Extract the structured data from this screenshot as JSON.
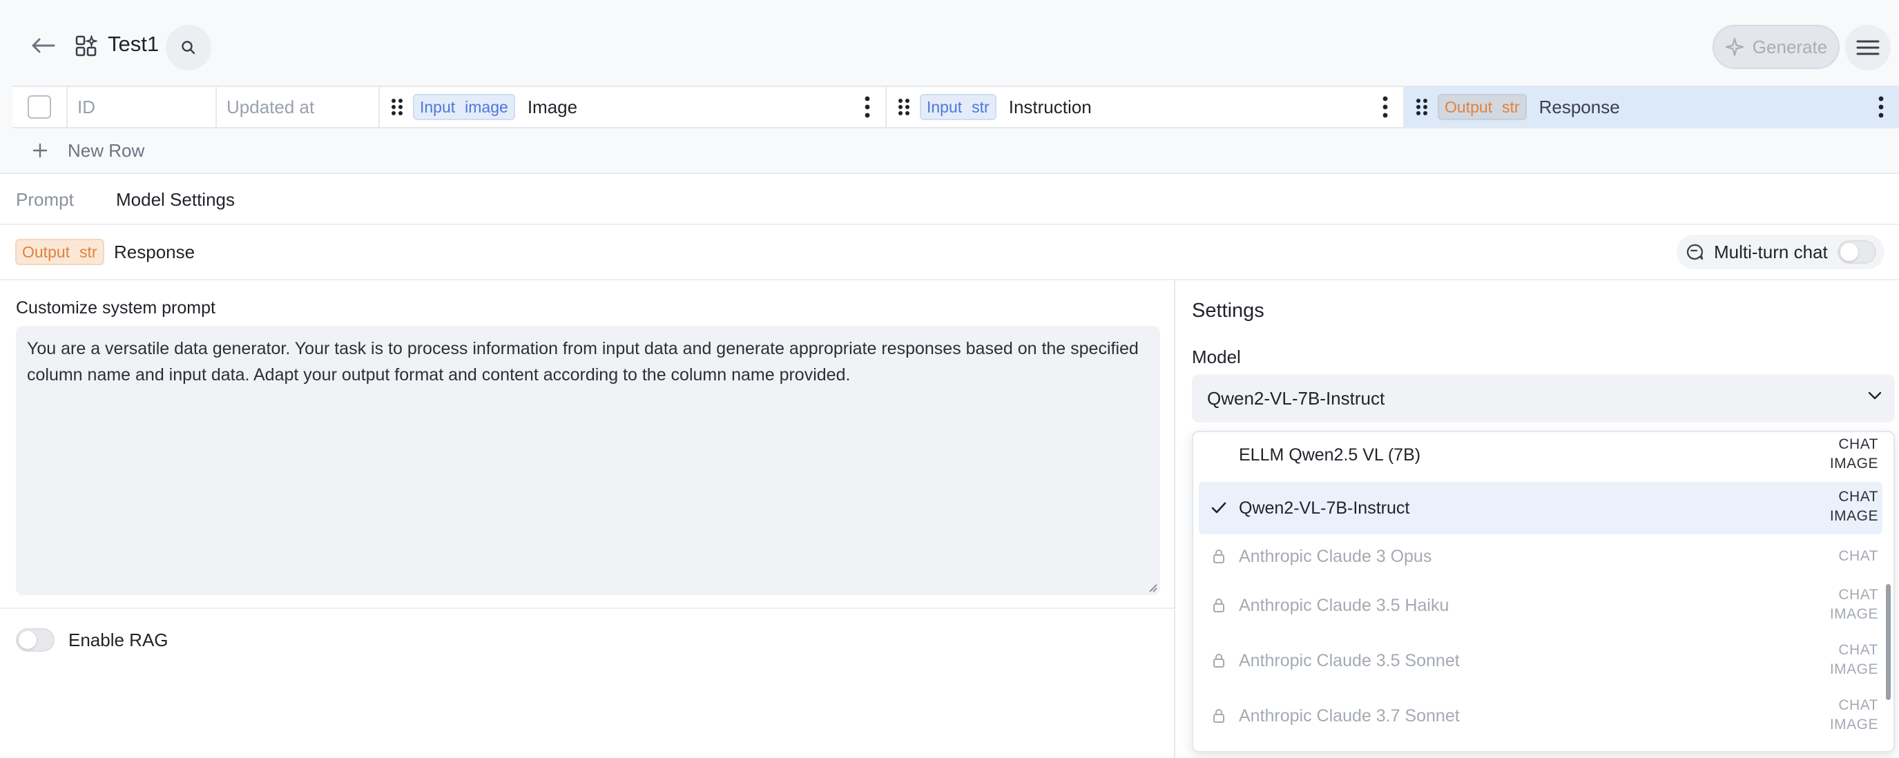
{
  "header": {
    "title": "Test1",
    "generate_label": "Generate",
    "icons": {
      "back": "arrow-left-icon",
      "table": "table-sparkle-icon",
      "search": "search-icon",
      "generate": "sparkle-icon",
      "menu": "hamburger-menu-icon"
    }
  },
  "table": {
    "columns": [
      {
        "name": "ID"
      },
      {
        "name": "Updated at"
      },
      {
        "kind": "Input",
        "type": "image",
        "name": "Image"
      },
      {
        "kind": "Input",
        "type": "str",
        "name": "Instruction"
      },
      {
        "kind": "Output",
        "type": "str",
        "name": "Response"
      }
    ],
    "new_row_label": "New Row"
  },
  "panel": {
    "tabs": [
      {
        "label": "Prompt"
      },
      {
        "label": "Model Settings"
      }
    ],
    "output_column": {
      "kind": "Output",
      "type": "str",
      "name": "Response"
    },
    "multi_turn_label": "Multi-turn chat",
    "system_prompt_label": "Customize system prompt",
    "system_prompt": "You are a versatile data generator. Your task is to process information from input data and generate appropriate responses based on the specified column name and input data. Adapt your output format and content according to the column name provided.",
    "enable_rag_label": "Enable RAG"
  },
  "settings": {
    "title": "Settings",
    "model_label": "Model",
    "selected_model": "Qwen2-VL-7B-Instruct",
    "options": [
      {
        "name": "ELLM Qwen2.5 VL (7B)",
        "caps": [
          "CHAT",
          "IMAGE"
        ],
        "locked": false,
        "selected": false
      },
      {
        "name": "Qwen2-VL-7B-Instruct",
        "caps": [
          "CHAT",
          "IMAGE"
        ],
        "locked": false,
        "selected": true
      },
      {
        "name": "Anthropic Claude 3 Opus",
        "caps": [
          "CHAT"
        ],
        "locked": true,
        "selected": false
      },
      {
        "name": "Anthropic Claude 3.5 Haiku",
        "caps": [
          "CHAT",
          "IMAGE"
        ],
        "locked": true,
        "selected": false
      },
      {
        "name": "Anthropic Claude 3.5 Sonnet",
        "caps": [
          "CHAT",
          "IMAGE"
        ],
        "locked": true,
        "selected": false
      },
      {
        "name": "Anthropic Claude 3.7 Sonnet",
        "caps": [
          "CHAT",
          "IMAGE"
        ],
        "locked": true,
        "selected": false
      }
    ]
  },
  "colors": {
    "input_tag": "#4d78d6",
    "output_tag": "#e0823e",
    "selected_column": "#dbe9f8",
    "selected_option": "#eaf1fb"
  }
}
